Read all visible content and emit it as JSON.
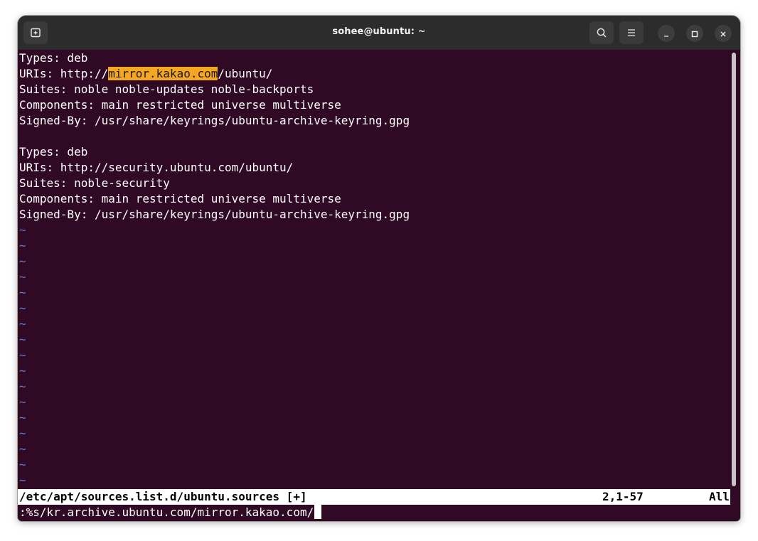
{
  "window": {
    "title": "sohee@ubuntu: ~"
  },
  "titlebar": {
    "new_tab_icon": "new-tab-icon",
    "search_icon": "search-icon",
    "menu_icon": "hamburger-menu-icon",
    "minimize_icon": "minimize-icon",
    "maximize_icon": "maximize-icon",
    "close_icon": "close-icon"
  },
  "editor": {
    "lines": [
      {
        "pre": "Types: deb",
        "hl": "",
        "post": ""
      },
      {
        "pre": "URIs: http://",
        "hl": "mirror.kakao.com",
        "post": "/ubuntu/"
      },
      {
        "pre": "Suites: noble noble-updates noble-backports",
        "hl": "",
        "post": ""
      },
      {
        "pre": "Components: main restricted universe multiverse",
        "hl": "",
        "post": ""
      },
      {
        "pre": "Signed-By: /usr/share/keyrings/ubuntu-archive-keyring.gpg",
        "hl": "",
        "post": ""
      },
      {
        "pre": "",
        "hl": "",
        "post": ""
      },
      {
        "pre": "Types: deb",
        "hl": "",
        "post": ""
      },
      {
        "pre": "URIs: http://security.ubuntu.com/ubuntu/",
        "hl": "",
        "post": ""
      },
      {
        "pre": "Suites: noble-security",
        "hl": "",
        "post": ""
      },
      {
        "pre": "Components: main restricted universe multiverse",
        "hl": "",
        "post": ""
      },
      {
        "pre": "Signed-By: /usr/share/keyrings/ubuntu-archive-keyring.gpg",
        "hl": "",
        "post": ""
      }
    ],
    "tilde_char": "~",
    "tilde_count": 17
  },
  "statusline": {
    "filename": "/etc/apt/sources.list.d/ubuntu.sources [+]",
    "position": "2,1-57",
    "scroll": "All"
  },
  "command_line": {
    "text": ":%s/kr.archive.ubuntu.com/mirror.kakao.com/"
  },
  "colors": {
    "terminal_bg": "#300a24",
    "highlight": "#f5a623",
    "tilde": "#5e7fd6"
  }
}
